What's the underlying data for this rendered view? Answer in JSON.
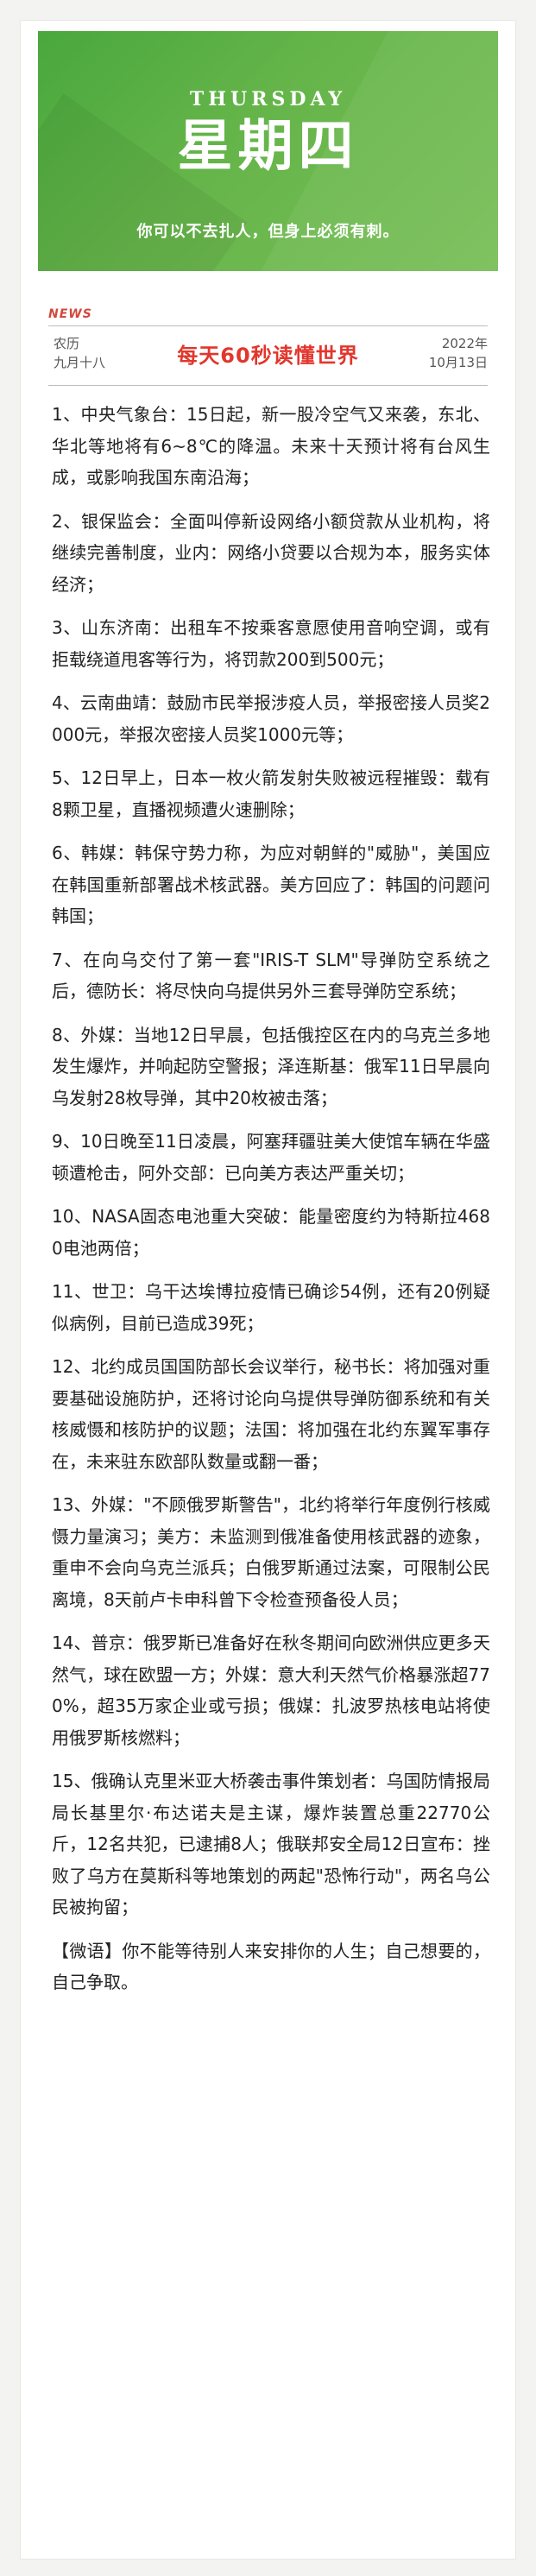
{
  "banner": {
    "weekday_en": "THURSDAY",
    "weekday_cn": "星期四",
    "motto": "你可以不去扎人，但身上必须有刺。",
    "gradient_colors": [
      "#49a83d",
      "#78bf57"
    ]
  },
  "header": {
    "news_tag": "NEWS",
    "lunar_line1": "农历",
    "lunar_line2": "九月十八",
    "title": "每天60秒读懂世界",
    "date_line1": "2022年",
    "date_line2": "10月13日",
    "title_color": "#e2362c",
    "tag_color": "#d04a3c"
  },
  "items": [
    "1、中央气象台：15日起，新一股冷空气又来袭，东北、华北等地将有6~8℃的降温。未来十天预计将有台风生成，或影响我国东南沿海；",
    "2、银保监会：全面叫停新设网络小额贷款从业机构，将继续完善制度，业内：网络小贷要以合规为本，服务实体经济；",
    "3、山东济南：出租车不按乘客意愿使用音响空调，或有拒载绕道甩客等行为，将罚款200到500元；",
    "4、云南曲靖：鼓励市民举报涉疫人员，举报密接人员奖2000元，举报次密接人员奖1000元等；",
    "5、12日早上，日本一枚火箭发射失败被远程摧毁：载有8颗卫星，直播视频遭火速删除；",
    "6、韩媒：韩保守势力称，为应对朝鲜的\"威胁\"，美国应在韩国重新部署战术核武器。美方回应了：韩国的问题问韩国；",
    "7、在向乌交付了第一套\"IRIS-T SLM\"导弹防空系统之后，德防长：将尽快向乌提供另外三套导弹防空系统；",
    "8、外媒：当地12日早晨，包括俄控区在内的乌克兰多地发生爆炸，并响起防空警报；泽连斯基：俄军11日早晨向乌发射28枚导弹，其中20枚被击落；",
    "9、10日晚至11日凌晨，阿塞拜疆驻美大使馆车辆在华盛顿遭枪击，阿外交部：已向美方表达严重关切；",
    "10、NASA固态电池重大突破：能量密度约为特斯拉4680电池两倍；",
    "11、世卫：乌干达埃博拉疫情已确诊54例，还有20例疑似病例，目前已造成39死；",
    "12、北约成员国国防部长会议举行，秘书长：将加强对重要基础设施防护，还将讨论向乌提供导弹防御系统和有关核威慑和核防护的议题；法国：将加强在北约东翼军事存在，未来驻东欧部队数量或翻一番；",
    "13、外媒：\"不顾俄罗斯警告\"，北约将举行年度例行核威慑力量演习；美方：未监测到俄准备使用核武器的迹象，重申不会向乌克兰派兵；白俄罗斯通过法案，可限制公民离境，8天前卢卡申科曾下令检查预备役人员；",
    "14、普京：俄罗斯已准备好在秋冬期间向欧洲供应更多天然气，球在欧盟一方；外媒：意大利天然气价格暴涨超770%，超35万家企业或亏损；俄媒：扎波罗热核电站将使用俄罗斯核燃料；",
    "15、俄确认克里米亚大桥袭击事件策划者：乌国防情报局局长基里尔·布达诺夫是主谋，爆炸装置总重22770公斤，12名共犯，已逮捕8人；俄联邦安全局12日宣布：挫败了乌方在莫斯科等地策划的两起\"恐怖行动\"，两名乌公民被拘留；",
    "【微语】你不能等待别人来安排你的人生；自己想要的，自己争取。"
  ]
}
